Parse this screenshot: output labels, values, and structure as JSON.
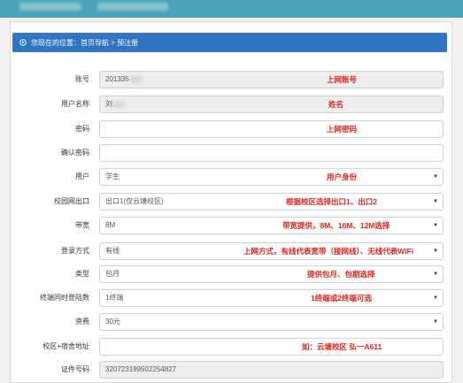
{
  "breadcrumb": {
    "text": "您现在的位置：首页导航 > 预注册"
  },
  "form": {
    "account": {
      "label": "账号",
      "value": "201335",
      "note": "上网账号"
    },
    "username": {
      "label": "用户名称",
      "value": "刘",
      "note": "姓名"
    },
    "password": {
      "label": "密码",
      "value": "",
      "note": "上网密码"
    },
    "confirm_password": {
      "label": "确认密码",
      "value": ""
    },
    "user_type": {
      "label": "用户",
      "value": "学生",
      "note": "用户身份"
    },
    "campus_exit": {
      "label": "校园网出口",
      "value": "出口1(仅云塘校区)",
      "note": "根据校区选择出口1、出口2"
    },
    "bandwidth": {
      "label": "带宽",
      "value": "8M",
      "note": "带宽提供，8M、10M、12M选择"
    },
    "login_mode": {
      "label": "登录方式",
      "value": "有线",
      "note": "上网方式，有线代表宽带（接网线）、无线代表WiFi"
    },
    "plan_type": {
      "label": "类型",
      "value": "包月",
      "note": "提供包月、包期选择"
    },
    "terminals": {
      "label": "终端同时登陆数",
      "value": "1终端",
      "note": "1终端或2终端可选"
    },
    "fee": {
      "label": "资费",
      "value": "30元"
    },
    "address": {
      "label": "校区+宿舍地址",
      "value": "",
      "note": "如：云塘校区 弘一A611"
    },
    "id_number": {
      "label": "证件号码",
      "value": "320723199502254827"
    }
  },
  "colors": {
    "header": "#4aa3b8",
    "breadcrumb": "#2f74c0",
    "annotation": "#e0211d"
  },
  "icons": {
    "breadcrumb": "location-icon",
    "select": "caret-down-icon"
  }
}
